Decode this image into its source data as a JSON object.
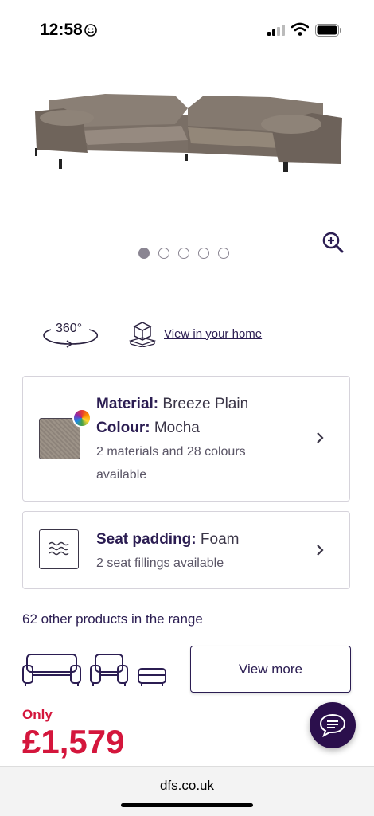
{
  "status_bar": {
    "time": "12:58"
  },
  "gallery": {
    "slide_count": 5,
    "active_index": 0
  },
  "tools": {
    "rotate_label": "360°",
    "view_in_home": "View in your home"
  },
  "material_card": {
    "material_label": "Material:",
    "material_value": "Breeze Plain",
    "colour_label": "Colour:",
    "colour_value": "Mocha",
    "availability": "2 materials and 28 colours available"
  },
  "padding_card": {
    "label": "Seat padding:",
    "value": "Foam",
    "availability": "2 seat fillings available"
  },
  "range": {
    "text": "62 other products in the range",
    "button": "View more"
  },
  "price": {
    "prefix": "Only",
    "amount": "£1,579"
  },
  "browser": {
    "url": "dfs.co.uk"
  },
  "colors": {
    "brand_purple": "#2b1d52",
    "price_red": "#d4163c"
  }
}
